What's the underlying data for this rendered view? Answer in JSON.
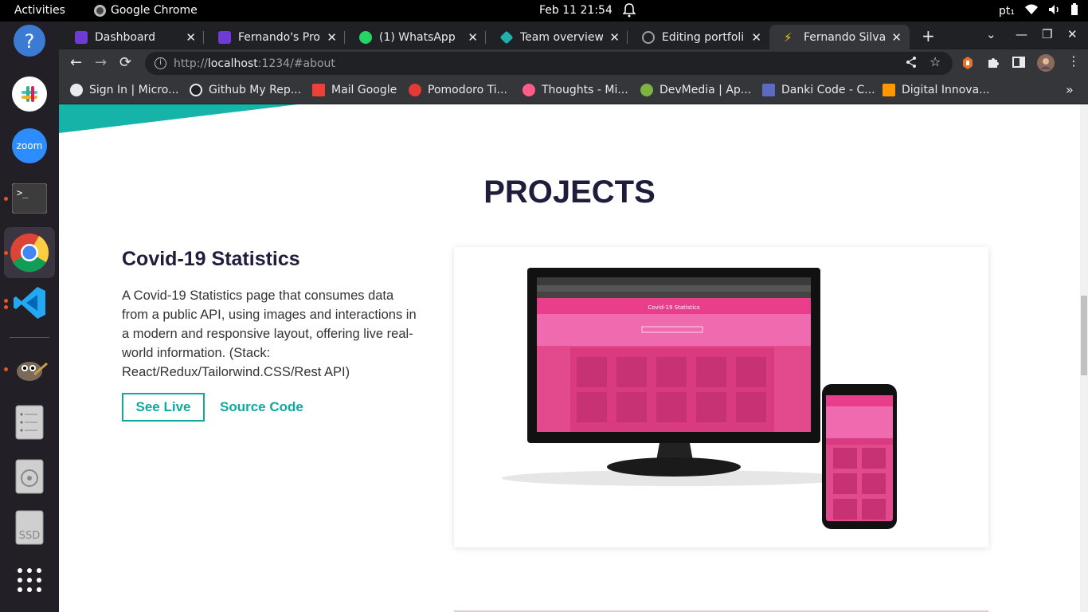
{
  "topbar": {
    "activities": "Activities",
    "app_name": "Google Chrome",
    "clock": "Feb 11  21:54",
    "lang": "pt₁"
  },
  "dock": {
    "items": [
      {
        "name": "help",
        "icon": "help-icon"
      },
      {
        "name": "slack",
        "icon": "slack-icon"
      },
      {
        "name": "zoom",
        "icon": "zoom-icon",
        "label": "zoom"
      },
      {
        "name": "terminal",
        "icon": "terminal-icon"
      },
      {
        "name": "chrome",
        "icon": "chrome-icon"
      },
      {
        "name": "vscode",
        "icon": "vscode-icon"
      },
      {
        "name": "gimp",
        "icon": "gimp-icon"
      },
      {
        "name": "files",
        "icon": "files-icon"
      },
      {
        "name": "disk",
        "icon": "disk-icon"
      },
      {
        "name": "ssd",
        "icon": "ssd-icon",
        "label": "SSD"
      },
      {
        "name": "apps",
        "icon": "apps-grid-icon"
      }
    ]
  },
  "tabs": [
    {
      "title": "Dashboard",
      "color": "#6e3bd6"
    },
    {
      "title": "Fernando's Prog",
      "color": "#6e3bd6"
    },
    {
      "title": "(1) WhatsApp",
      "color": "#25d366"
    },
    {
      "title": "Team overview |",
      "color": "#20b2aa"
    },
    {
      "title": "Editing portfolio",
      "color": "#9e9e9e"
    },
    {
      "title": "Fernando Silva |",
      "color": "#f5c518"
    }
  ],
  "toolbar": {
    "url_scheme": "http://",
    "url_host": "localhost",
    "url_rest": ":1234/#about"
  },
  "bookmarks": [
    {
      "label": "Sign In | Micro...",
      "color": "#e8eaed"
    },
    {
      "label": "Github My Rep...",
      "color": "#e8eaed"
    },
    {
      "label": "Mail Google",
      "color": "#ea4335"
    },
    {
      "label": "Pomodoro Ti...",
      "color": "#e53935"
    },
    {
      "label": "Thoughts - Mi...",
      "color": "#ff5c8a"
    },
    {
      "label": "DevMedia | Ap...",
      "color": "#7cb342"
    },
    {
      "label": "Danki Code - C...",
      "color": "#5c6bc0"
    },
    {
      "label": "Digital Innova...",
      "color": "#ff9800"
    }
  ],
  "page": {
    "section_title": "PROJECTS",
    "project": {
      "title": "Covid-19 Statistics",
      "description": "A Covid-19 Statistics page that consumes data from a public API, using images and interactions in a modern and responsive layout, offering live real-world information. (Stack: React/Redux/Tailorwind.CSS/Rest API)",
      "see_live": "See Live",
      "source_code": "Source Code"
    },
    "preview": {
      "app_title": "Covid-19 Statistics",
      "accent": "#e83e8c",
      "teal": "#0fa9a0"
    }
  }
}
